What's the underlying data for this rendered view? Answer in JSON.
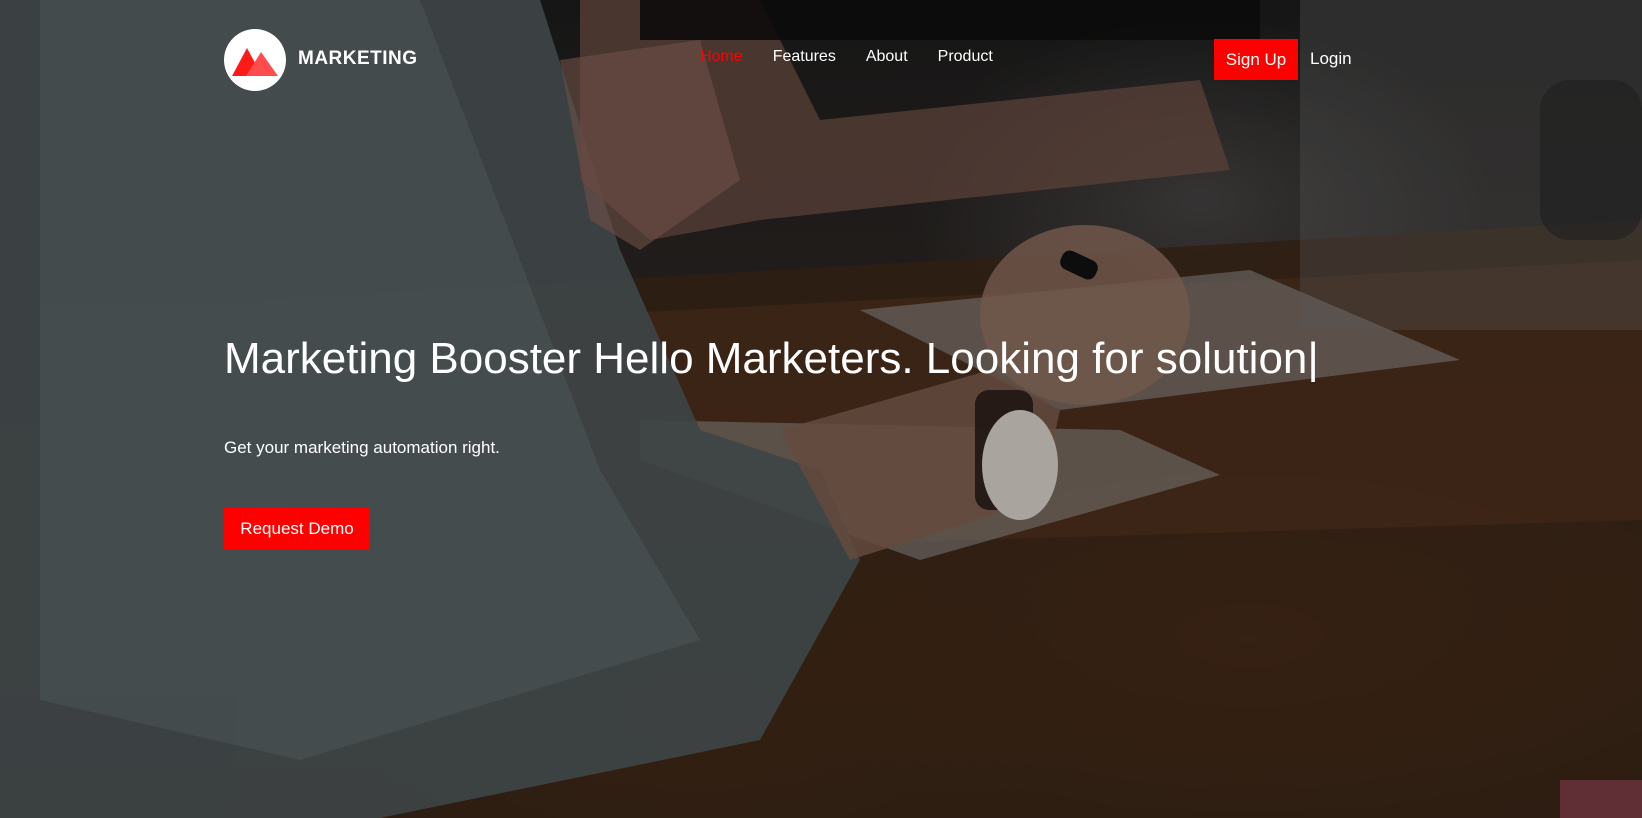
{
  "brand": {
    "name": "MARKETING",
    "logo_icon": "mountain-logo-icon",
    "accent_color": "#ff0000"
  },
  "nav": {
    "items": [
      {
        "label": "Home",
        "active": true
      },
      {
        "label": "Features",
        "active": false
      },
      {
        "label": "About",
        "active": false
      },
      {
        "label": "Product",
        "active": false
      }
    ],
    "signup_label": "Sign Up",
    "login_label": "Login"
  },
  "hero": {
    "headline": "Marketing Booster Hello Marketers. Looking for solution|",
    "subline": "Get your marketing automation right.",
    "cta_label": "Request Demo",
    "background": "dark-photo-desk-hands-watch"
  }
}
